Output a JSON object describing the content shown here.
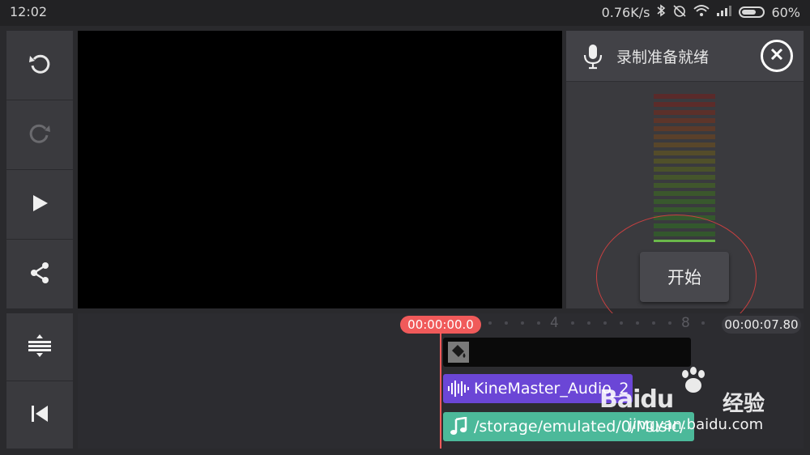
{
  "status_bar": {
    "time": "12:02",
    "network_speed": "0.76K/s",
    "battery": "60%"
  },
  "left_toolbar": {
    "buttons": [
      {
        "name": "undo-button",
        "icon": "undo-icon"
      },
      {
        "name": "redo-button",
        "icon": "redo-icon"
      },
      {
        "name": "play-button",
        "icon": "play-icon"
      },
      {
        "name": "share-button",
        "icon": "share-icon"
      }
    ],
    "bottom_buttons": [
      {
        "name": "expand-tracks-button",
        "icon": "expand-vertical-icon"
      },
      {
        "name": "skip-to-start-button",
        "icon": "skip-start-icon"
      }
    ]
  },
  "record_panel": {
    "title": "录制准备就绪",
    "start_label": "开始",
    "mic_icon": "microphone-icon",
    "close_icon": "close-icon"
  },
  "timeline": {
    "current_time": "00:00:00.0",
    "end_time": "00:00:07.80",
    "ruler_labels": [
      "4",
      "8"
    ],
    "tracks": [
      {
        "type": "video",
        "icon": "paint-bucket-icon",
        "label": ""
      },
      {
        "type": "audio",
        "icon": "waveform-icon",
        "label": "KineMaster_Audio_2"
      },
      {
        "type": "music",
        "icon": "music-note-icon",
        "label": "/storage/emulated/0/Music/"
      }
    ]
  },
  "watermark": {
    "brand": "Baidu",
    "brand_cn": "经验",
    "url": "jingyan.baidu.com"
  },
  "colors": {
    "playhead": "#f05a5a",
    "audio_track": "#6b46d6",
    "music_track": "#4cb99a"
  }
}
